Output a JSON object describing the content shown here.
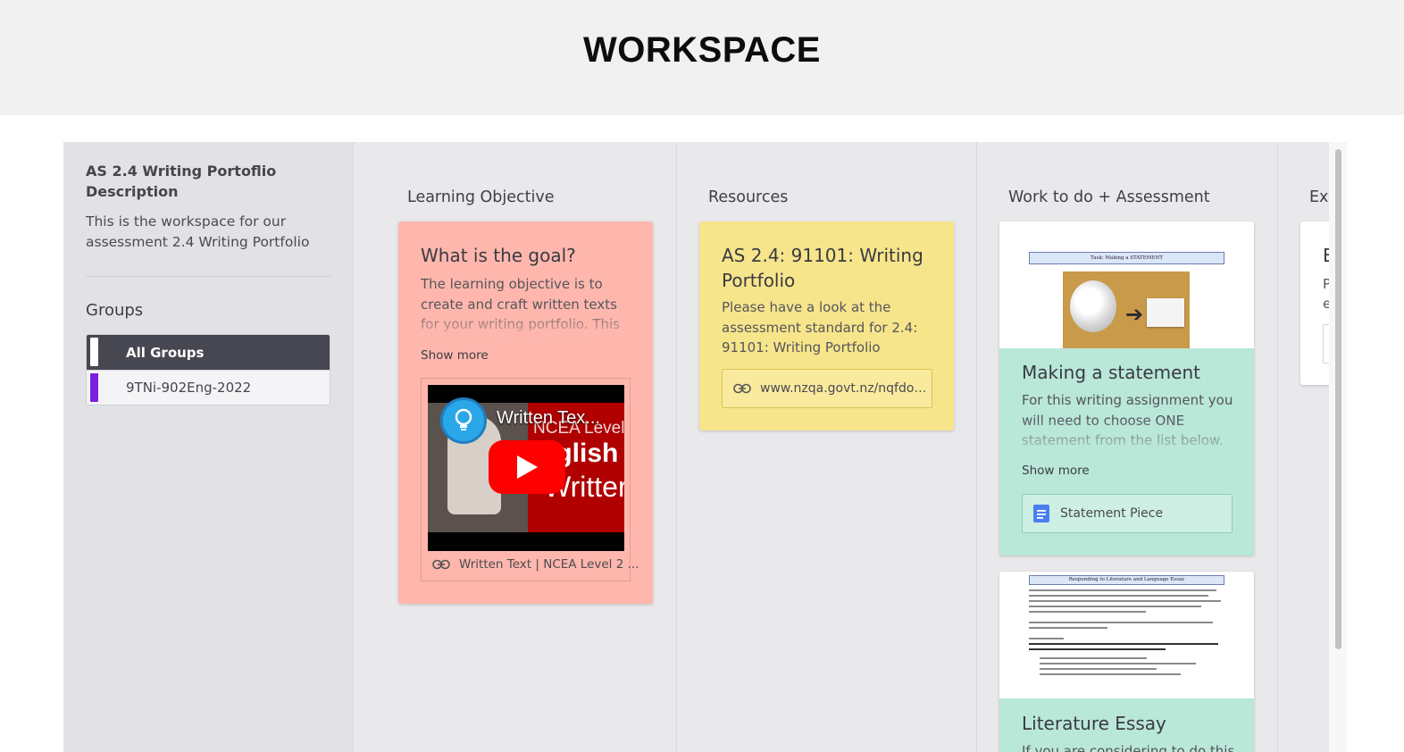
{
  "header": {
    "title": "WORKSPACE"
  },
  "sidebar": {
    "title": "AS 2.4 Writing Portoflio Description",
    "description": "This is the workspace for our assessment 2.4 Writing Portfolio",
    "groups_title": "Groups",
    "groups": [
      {
        "label": "All Groups",
        "color": "#ffffff",
        "active": true
      },
      {
        "label": "9TNi-902Eng-2022",
        "color": "#7b1fe0",
        "active": false
      }
    ]
  },
  "columns": [
    {
      "title": "Learning Objective",
      "cards": [
        {
          "title": "What is the goal?",
          "body": "The learning objective is to create and craft written texts for your writing portfolio. This assessment is asking you create and craft",
          "show_more": "Show more",
          "video": {
            "title": "Written Tex...",
            "line1": "NCEA Level",
            "line2": "nglish",
            "line3": "Writter"
          },
          "link": "Written Text | NCEA Level 2 ...",
          "color": "#ffb7ad"
        }
      ]
    },
    {
      "title": "Resources",
      "cards": [
        {
          "title": "AS 2.4: 91101: Writing Portfolio",
          "body": "Please have a look at the assessment standard for 2.4: 91101: Writing Portfolio",
          "link": "www.nzqa.govt.nz/nqfdoc...",
          "color": "#f7e58b"
        }
      ]
    },
    {
      "title": "Work to do + Assessment",
      "cards": [
        {
          "title": "Making a statement",
          "body": "For this writing assignment you will need to choose ONE statement from the list below. Once you have chosen a",
          "show_more": "Show more",
          "thumb_heading": "Task: Making a STATEMENT",
          "attachment": "Statement Piece",
          "color": "#b9e7d8"
        },
        {
          "title": "Literature Essay",
          "body": "If you are considering to do this",
          "thumb_heading": "Responding to Literature and Language Essay",
          "color": "#b9e7d8"
        }
      ]
    },
    {
      "title": "Exe",
      "cards": [
        {
          "title": "E",
          "body": "P e",
          "color": "#ffffff"
        }
      ]
    }
  ],
  "icons": {
    "link": "link-icon",
    "doc": "google-doc-icon",
    "play": "play-icon",
    "lightbulb": "lightbulb-icon"
  }
}
